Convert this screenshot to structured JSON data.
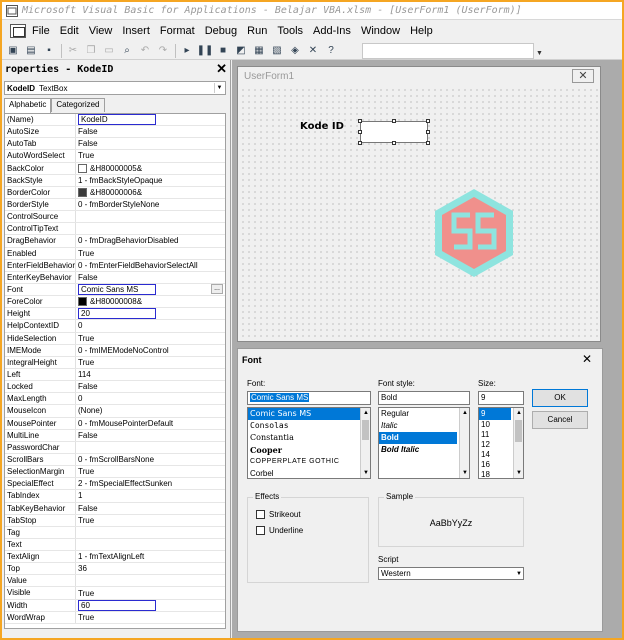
{
  "window": {
    "title": "Microsoft Visual Basic for Applications - Belajar VBA.xlsm - [UserForm1 (UserForm)]"
  },
  "menu": [
    "File",
    "Edit",
    "View",
    "Insert",
    "Format",
    "Debug",
    "Run",
    "Tools",
    "Add-Ins",
    "Window",
    "Help"
  ],
  "properties": {
    "title": "roperties - KodeID",
    "object_name": "KodeID",
    "object_type": "TextBox",
    "tabs": [
      "Alphabetic",
      "Categorized"
    ],
    "rows": [
      {
        "name": "(Name)",
        "value": "KodeID"
      },
      {
        "name": "AutoSize",
        "value": "False"
      },
      {
        "name": "AutoTab",
        "value": "False"
      },
      {
        "name": "AutoWordSelect",
        "value": "True"
      },
      {
        "name": "BackColor",
        "value": "&H80000005&"
      },
      {
        "name": "BackStyle",
        "value": "1 - fmBackStyleOpaque"
      },
      {
        "name": "BorderColor",
        "value": "&H80000006&"
      },
      {
        "name": "BorderStyle",
        "value": "0 - fmBorderStyleNone"
      },
      {
        "name": "ControlSource",
        "value": ""
      },
      {
        "name": "ControlTipText",
        "value": ""
      },
      {
        "name": "DragBehavior",
        "value": "0 - fmDragBehaviorDisabled"
      },
      {
        "name": "Enabled",
        "value": "True"
      },
      {
        "name": "EnterFieldBehavior",
        "value": "0 - fmEnterFieldBehaviorSelectAll"
      },
      {
        "name": "EnterKeyBehavior",
        "value": "False"
      },
      {
        "name": "Font",
        "value": "Comic Sans MS"
      },
      {
        "name": "ForeColor",
        "value": "&H80000008&"
      },
      {
        "name": "Height",
        "value": "20"
      },
      {
        "name": "HelpContextID",
        "value": "0"
      },
      {
        "name": "HideSelection",
        "value": "True"
      },
      {
        "name": "IMEMode",
        "value": "0 - fmIMEModeNoControl"
      },
      {
        "name": "IntegralHeight",
        "value": "True"
      },
      {
        "name": "Left",
        "value": "114"
      },
      {
        "name": "Locked",
        "value": "False"
      },
      {
        "name": "MaxLength",
        "value": "0"
      },
      {
        "name": "MouseIcon",
        "value": "(None)"
      },
      {
        "name": "MousePointer",
        "value": "0 - fmMousePointerDefault"
      },
      {
        "name": "MultiLine",
        "value": "False"
      },
      {
        "name": "PasswordChar",
        "value": ""
      },
      {
        "name": "ScrollBars",
        "value": "0 - fmScrollBarsNone"
      },
      {
        "name": "SelectionMargin",
        "value": "True"
      },
      {
        "name": "SpecialEffect",
        "value": "2 - fmSpecialEffectSunken"
      },
      {
        "name": "TabIndex",
        "value": "1"
      },
      {
        "name": "TabKeyBehavior",
        "value": "False"
      },
      {
        "name": "TabStop",
        "value": "True"
      },
      {
        "name": "Tag",
        "value": ""
      },
      {
        "name": "Text",
        "value": ""
      },
      {
        "name": "TextAlign",
        "value": "1 - fmTextAlignLeft"
      },
      {
        "name": "Top",
        "value": "36"
      },
      {
        "name": "Value",
        "value": ""
      },
      {
        "name": "Visible",
        "value": "True"
      },
      {
        "name": "Width",
        "value": "60"
      },
      {
        "name": "WordWrap",
        "value": "True"
      }
    ],
    "colors": {
      "backcolor": "#ffffff",
      "bordercolor": "#3a3a3a",
      "forecolor": "#000000"
    }
  },
  "userform": {
    "title": "UserForm1",
    "label": "Kode ID",
    "logo_colors": {
      "outer": "#8ee4df",
      "inner": "#f0908c"
    }
  },
  "font_dialog": {
    "title": "Font",
    "font_label": "Font:",
    "font_value": "Comic Sans MS",
    "fonts": [
      "Comic Sans MS",
      "Consolas",
      "Constantia",
      "Cooper",
      "COPPERPLATE GOTHIC",
      "Corbel"
    ],
    "style_label": "Font style:",
    "style_value": "Bold",
    "styles": [
      "Regular",
      "Italic",
      "Bold",
      "Bold Italic"
    ],
    "size_label": "Size:",
    "size_value": "9",
    "sizes": [
      "9",
      "10",
      "11",
      "12",
      "14",
      "16",
      "18"
    ],
    "ok": "OK",
    "cancel": "Cancel",
    "effects_label": "Effects",
    "strikeout": "Strikeout",
    "underline": "Underline",
    "sample_label": "Sample",
    "sample_text": "AaBbYyZz",
    "script_label": "Script",
    "script_value": "Western"
  }
}
